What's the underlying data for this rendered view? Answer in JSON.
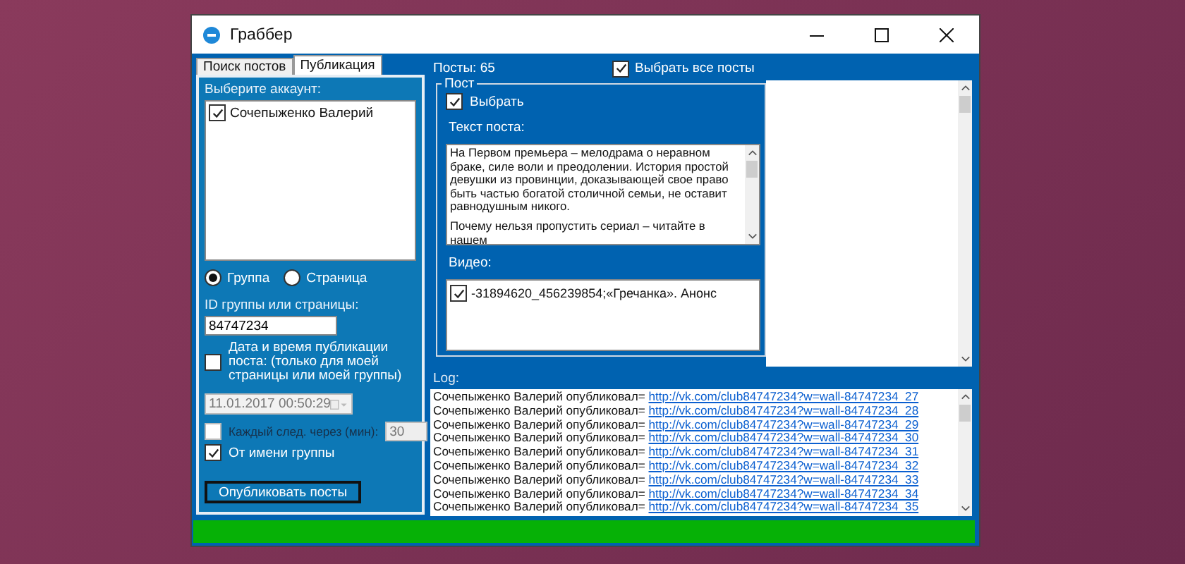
{
  "window": {
    "title": "Граббер"
  },
  "tabs": [
    {
      "label": "Поиск постов",
      "selected": false
    },
    {
      "label": "Публикация",
      "selected": true
    }
  ],
  "publish": {
    "account_label": "Выберите аккаунт:",
    "accounts": [
      {
        "name": "Сочепыженко Валерий",
        "checked": true
      }
    ],
    "targets": [
      {
        "label": "Группа",
        "selected": true
      },
      {
        "label": "Страница",
        "selected": false
      }
    ],
    "id_label": "ID группы или страницы:",
    "id_value": "84747234",
    "schedule": {
      "checked": false,
      "label": "Дата и время публикации поста: (только для моей страницы или моей группы)"
    },
    "date": {
      "value": "11.01.2017 00:50:29",
      "disabled": true
    },
    "interval": {
      "checked": false,
      "disabled": true,
      "label": "Каждый след. через (мин):",
      "value": "30"
    },
    "as_group": {
      "checked": true,
      "label": "От имени группы"
    },
    "button": "Опубликовать посты"
  },
  "posts": {
    "count": "Посты: 65",
    "select_all": {
      "checked": true,
      "label": "Выбрать все посты"
    },
    "items": [
      {
        "legend": "Пост",
        "select": {
          "checked": true,
          "label": "Выбрать"
        },
        "text_label": "Текст поста:",
        "text": [
          "На Первом премьера – мелодрама о неравном браке, силе воли и преодолении. История простой девушки из провинции, доказывающей свое право быть частью богатой столичной семьи, не оставит равнодушным никого.",
          "Почему нельзя пропустить сериал – читайте в нашем"
        ],
        "video_label": "Видео:",
        "videos": [
          {
            "label": "-31894620_456239854;«Гречанка». Анонс",
            "checked": true
          }
        ]
      }
    ]
  },
  "log": {
    "label": "Log:",
    "entries": [
      {
        "text": "Сочепыженко Валерий опубликовал=",
        "link": "http://vk.com/club84747234?w=wall-84747234_27"
      },
      {
        "text": "Сочепыженко Валерий опубликовал=",
        "link": "http://vk.com/club84747234?w=wall-84747234_28"
      },
      {
        "text": "Сочепыженко Валерий опубликовал=",
        "link": "http://vk.com/club84747234?w=wall-84747234_29"
      },
      {
        "text": "Сочепыженко Валерий опубликовал=",
        "link": "http://vk.com/club84747234?w=wall-84747234_30"
      },
      {
        "text": "Сочепыженко Валерий опубликовал=",
        "link": "http://vk.com/club84747234?w=wall-84747234_31"
      },
      {
        "text": "Сочепыженко Валерий опубликовал=",
        "link": "http://vk.com/club84747234?w=wall-84747234_32"
      },
      {
        "text": "Сочепыженко Валерий опубликовал=",
        "link": "http://vk.com/club84747234?w=wall-84747234_33"
      },
      {
        "text": "Сочепыженко Валерий опубликовал=",
        "link": "http://vk.com/club84747234?w=wall-84747234_34"
      },
      {
        "text": "Сочепыженко Валерий опубликовал=",
        "link": "http://vk.com/club84747234?w=wall-84747234_35"
      }
    ]
  },
  "progress": {
    "level": 1
  }
}
